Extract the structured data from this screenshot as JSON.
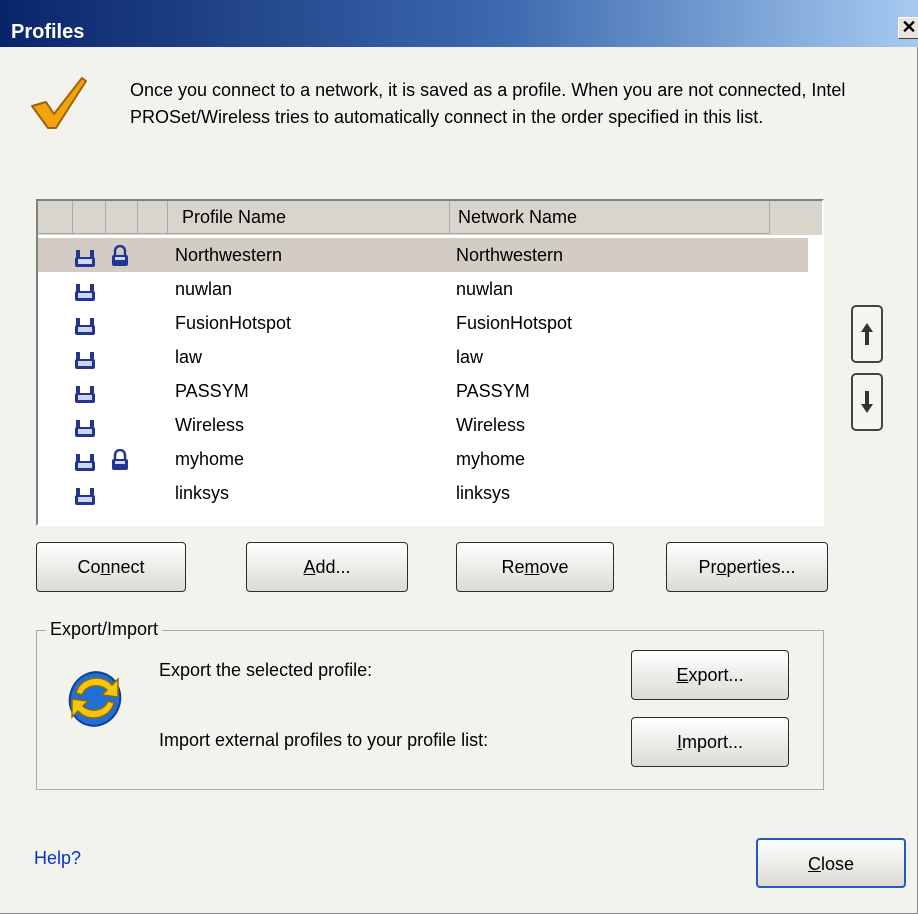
{
  "window": {
    "title": "Profiles",
    "close_glyph": "✕"
  },
  "intro_text": "Once you connect to a network, it is saved as a profile. When you are not connected, Intel PROSet/Wireless tries to automatically connect in the order specified in this list.",
  "table": {
    "columns": [
      "Profile Name",
      "Network Name"
    ],
    "rows": [
      {
        "profile": "Northwestern",
        "network": "Northwestern",
        "locked": true,
        "selected": true
      },
      {
        "profile": "nuwlan",
        "network": "nuwlan",
        "locked": false
      },
      {
        "profile": "FusionHotspot",
        "network": "FusionHotspot",
        "locked": false
      },
      {
        "profile": "law",
        "network": "law",
        "locked": false
      },
      {
        "profile": "PASSYM",
        "network": "PASSYM",
        "locked": false
      },
      {
        "profile": "Wireless",
        "network": "Wireless",
        "locked": false
      },
      {
        "profile": "myhome",
        "network": "myhome",
        "locked": true
      },
      {
        "profile": "linksys",
        "network": "linksys",
        "locked": false
      }
    ]
  },
  "buttons": {
    "connect": {
      "before": "Co",
      "key": "n",
      "after": "nect"
    },
    "add": {
      "before": "",
      "key": "A",
      "after": "dd..."
    },
    "remove": {
      "before": "Re",
      "key": "m",
      "after": "ove"
    },
    "properties": {
      "before": "Pr",
      "key": "o",
      "after": "perties..."
    },
    "export": {
      "before": "",
      "key": "E",
      "after": "xport..."
    },
    "import": {
      "before": "",
      "key": "I",
      "after": "mport..."
    },
    "close": {
      "before": "",
      "key": "C",
      "after": "lose"
    }
  },
  "export_import": {
    "group_label": "Export/Import",
    "export_text": "Export the selected profile:",
    "import_text": "Import external profiles to your profile list:"
  },
  "help_link": "Help?",
  "icons": [
    "checkmark-icon",
    "network-icon",
    "lock-icon",
    "arrow-up-icon",
    "arrow-down-icon",
    "sync-icon"
  ],
  "colors": {
    "title_bar": "#0a246a",
    "selected_row": "#d3ccc4",
    "help_link": "#0b2fcf"
  }
}
